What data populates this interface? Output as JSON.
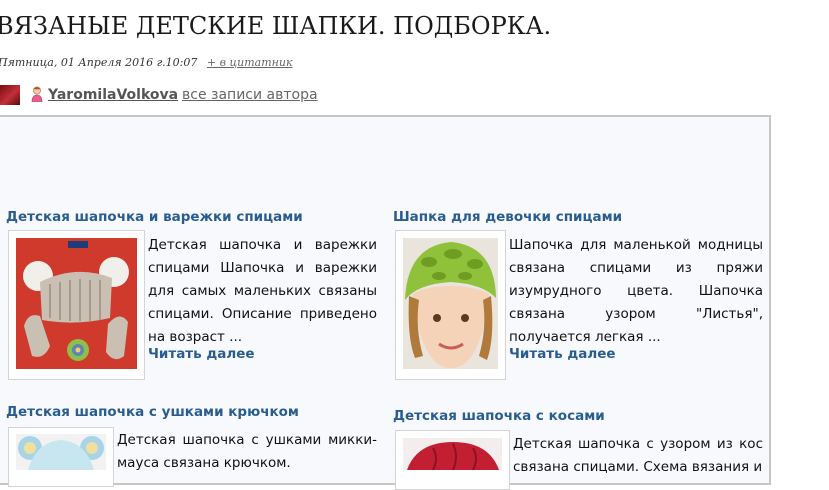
{
  "post": {
    "title": "ВЯЗАНЫЕ ДЕТСКИЕ ШАПКИ. ПОДБОРКА.",
    "date": "Пятница, 01 Апреля 2016 г.10:07",
    "quote_link": "+ в цитатник",
    "author": "YaromilaVolkova",
    "all_posts_link": "все записи автора"
  },
  "cards": [
    {
      "title": "Детская шапочка и варежки спицами",
      "text": "Детская шапочка и варежки спицами Шапочка и варежки для самых маленьких связаны спицами. Описание приведено на возраст ...",
      "read_more": "Читать далее",
      "image_icon": "knitted-hat-mittens-photo"
    },
    {
      "title": "Шапка для девочки спицами",
      "text": "Шапочка для маленькой модницы связана спицами из пряжи изумрудного цвета. Шапочка связана узором \"Листья\", получается легкая ...",
      "read_more": "Читать далее",
      "image_icon": "girl-green-hat-photo"
    },
    {
      "title": "Детская шапочка с ушками крючком",
      "text": "Детская шапочка с ушками микки-мауса связана крючком.",
      "image_icon": "mickey-hat-photo"
    },
    {
      "title": "Детская шапочка с косами",
      "text": "Детская шапочка с узором из кос связана спицами. Схема вязания и",
      "image_icon": "red-cable-hat-photo"
    }
  ],
  "colors": {
    "link": "#2a5d8f",
    "frame_border": "#c6c6c6",
    "frame_bg": "#f7f9fc"
  }
}
